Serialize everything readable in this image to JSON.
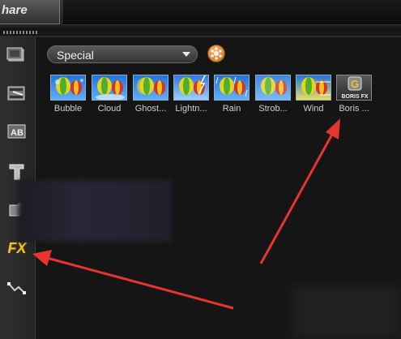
{
  "header": {
    "share_tab": "hare"
  },
  "sidebar": {
    "items": [
      {
        "name": "capture-icon"
      },
      {
        "name": "storyboard-icon"
      },
      {
        "name": "transition-ab-icon"
      },
      {
        "name": "title-t-icon"
      },
      {
        "name": "graphic-icon"
      },
      {
        "name": "fx-filter-icon",
        "label": "FX"
      },
      {
        "name": "path-motion-icon"
      }
    ]
  },
  "category": {
    "selected": "Special"
  },
  "effects": [
    {
      "label": "Bubble"
    },
    {
      "label": "Cloud"
    },
    {
      "label": "Ghost..."
    },
    {
      "label": "Lightn..."
    },
    {
      "label": "Rain"
    },
    {
      "label": "Strob..."
    },
    {
      "label": "Wind"
    },
    {
      "label": "Boris ...",
      "thumb_text": "BORIS FX"
    }
  ],
  "colors": {
    "arrow": "#e8342e",
    "fx_icon": "#f2c230",
    "options_button": "#e08a34"
  }
}
